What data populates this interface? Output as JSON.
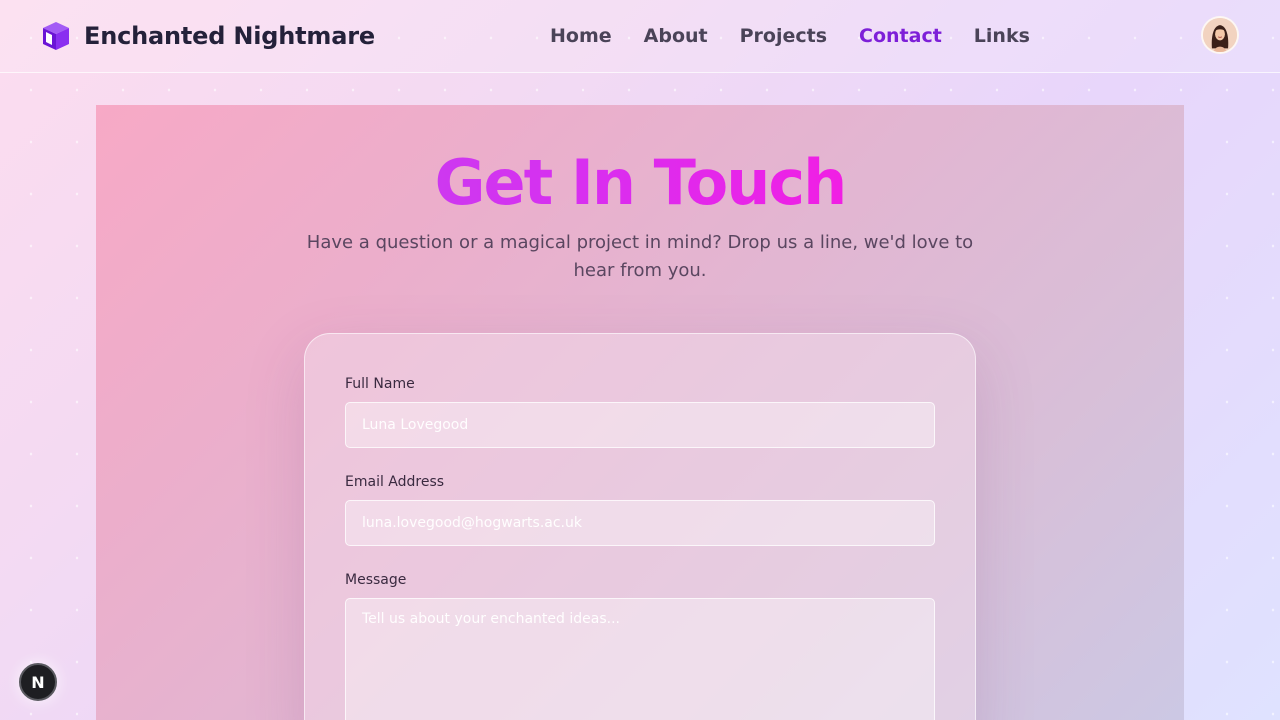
{
  "brand": {
    "name": "Enchanted Nightmare",
    "icon": "cube-icon",
    "accent": "#7d1fd8"
  },
  "nav": {
    "items": [
      {
        "label": "Home",
        "active": false
      },
      {
        "label": "About",
        "active": false
      },
      {
        "label": "Projects",
        "active": false
      },
      {
        "label": "Contact",
        "active": true
      },
      {
        "label": "Links",
        "active": false
      }
    ]
  },
  "user": {
    "avatar": "avatar-icon"
  },
  "contact": {
    "title": "Get In Touch",
    "subtitle": "Have a question or a magical project in mind? Drop us a line, we'd love to hear from you.",
    "form": {
      "name_label": "Full Name",
      "name_placeholder": "Luna Lovegood",
      "email_label": "Email Address",
      "email_placeholder": "luna.lovegood@hogwarts.ac.uk",
      "message_label": "Message",
      "message_placeholder": "Tell us about your enchanted ideas..."
    }
  },
  "dev_badge": {
    "label": "N"
  },
  "colors": {
    "title_start": "#b44cf0",
    "title_end": "#f21ee3",
    "active_nav": "#7d1fd8"
  }
}
